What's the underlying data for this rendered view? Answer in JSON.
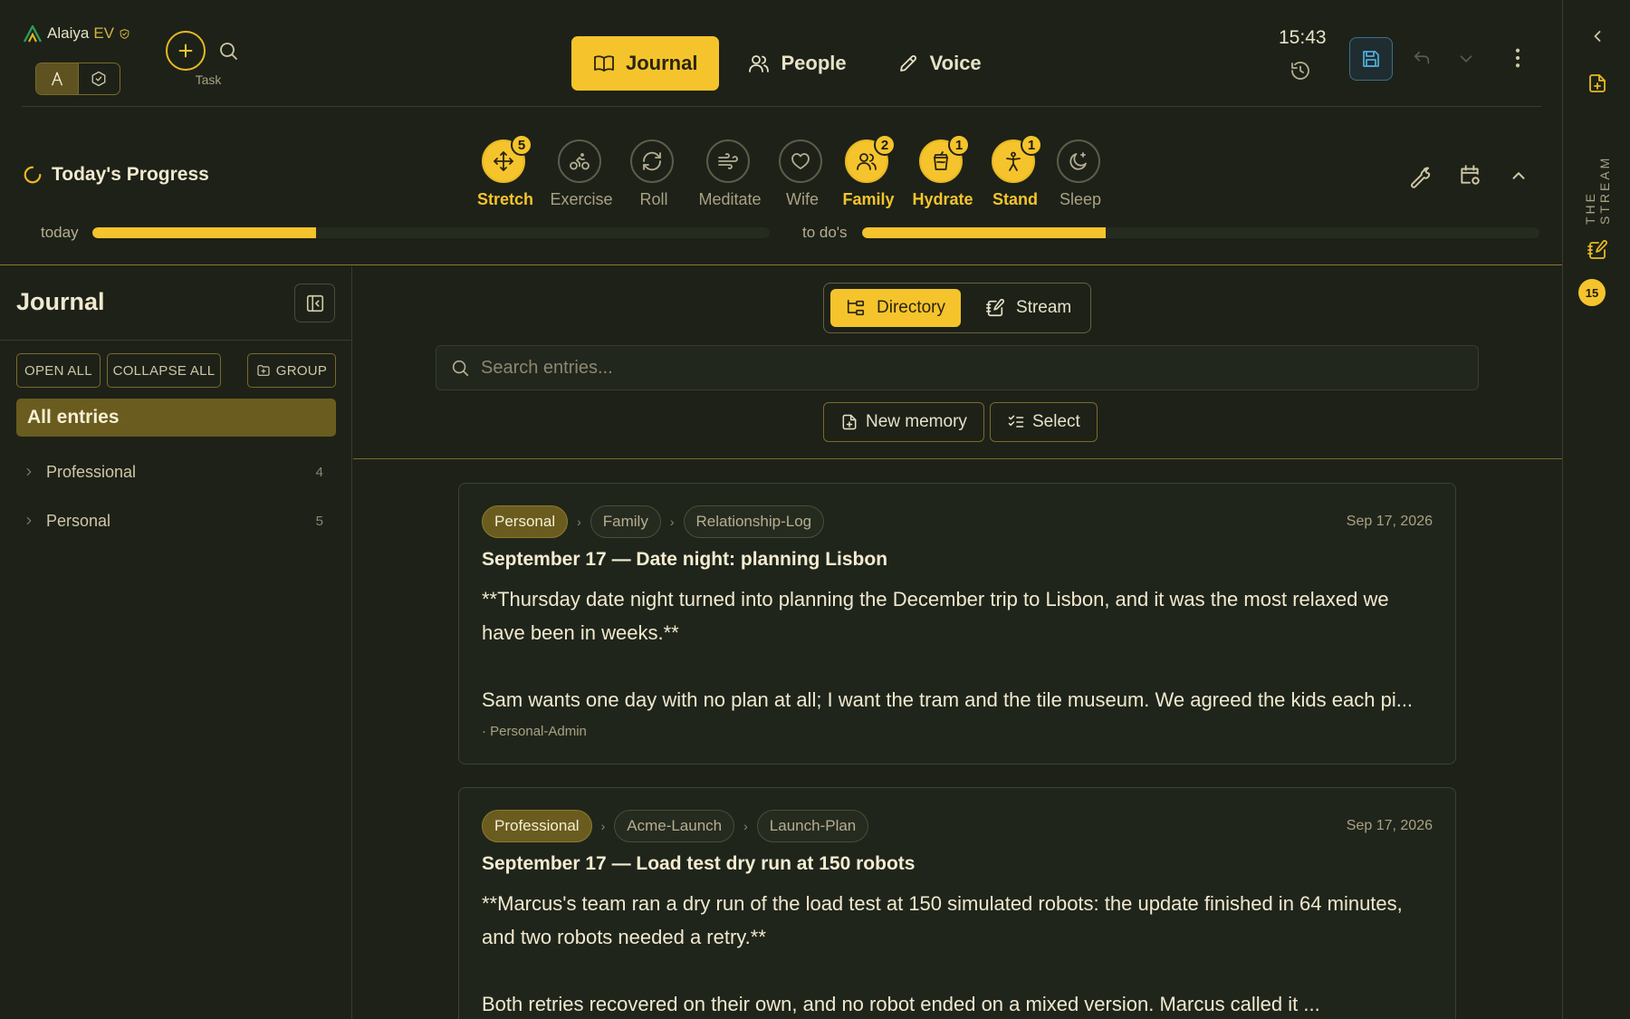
{
  "app": {
    "name": "Alaiya",
    "suffix": "EV",
    "add_task_label": "Task"
  },
  "nav": {
    "tabs": [
      {
        "label": "Journal",
        "icon": "book-icon",
        "active": true
      },
      {
        "label": "People",
        "icon": "users-icon",
        "active": false
      },
      {
        "label": "Voice",
        "icon": "pencil-icon",
        "active": false
      }
    ]
  },
  "header": {
    "clock": "15:43"
  },
  "progress": {
    "title": "Today's Progress",
    "today_label": "today",
    "todo_label": "to do's",
    "today_fraction": 0.33,
    "todo_fraction": 0.36,
    "habits": [
      {
        "label": "Stretch",
        "icon": "move-icon",
        "count": "5",
        "done": true
      },
      {
        "label": "Exercise",
        "icon": "bike-icon",
        "count": "",
        "done": false
      },
      {
        "label": "Roll",
        "icon": "refresh-icon",
        "count": "",
        "done": false
      },
      {
        "label": "Meditate",
        "icon": "wind-icon",
        "count": "",
        "done": false
      },
      {
        "label": "Wife",
        "icon": "heart-icon",
        "count": "",
        "done": false
      },
      {
        "label": "Family",
        "icon": "users-icon",
        "count": "2",
        "done": true
      },
      {
        "label": "Hydrate",
        "icon": "cup-icon",
        "count": "1",
        "done": true
      },
      {
        "label": "Stand",
        "icon": "person-icon",
        "count": "1",
        "done": true
      },
      {
        "label": "Sleep",
        "icon": "moon-icon",
        "count": "",
        "done": false
      }
    ]
  },
  "sidebar": {
    "title": "Journal",
    "open_all": "OPEN ALL",
    "collapse_all": "COLLAPSE ALL",
    "group": "GROUP",
    "all_entries": "All entries",
    "folders": [
      {
        "label": "Professional",
        "count": "4"
      },
      {
        "label": "Personal",
        "count": "5"
      }
    ]
  },
  "main": {
    "views": [
      {
        "label": "Directory",
        "active": true
      },
      {
        "label": "Stream",
        "active": false
      }
    ],
    "search_placeholder": "Search entries...",
    "new_memory": "New memory",
    "select": "Select",
    "entries": [
      {
        "crumbs": [
          "Personal",
          "Family",
          "Relationship-Log"
        ],
        "date": "Sep 17, 2026",
        "title": "September 17 — Date night: planning Lisbon",
        "p1": "**Thursday date night turned into planning the December trip to Lisbon, and it was the most relaxed we have been in weeks.**",
        "p2": "Sam wants one day with no plan at all; I want the tram and the tile museum. We agreed the kids each pi...",
        "meta": "· Personal-Admin"
      },
      {
        "crumbs": [
          "Professional",
          "Acme-Launch",
          "Launch-Plan"
        ],
        "date": "Sep 17, 2026",
        "title": "September 17 — Load test dry run at 150 robots",
        "p1": "**Marcus's team ran a dry run of the load test at 150 simulated robots: the update finished in 64 minutes, and two robots needed a retry.**",
        "p2": "Both retries recovered on their own, and no robot ended on a mixed version. Marcus called it ...",
        "meta": ""
      }
    ]
  },
  "rail": {
    "title": "THE STREAM",
    "badge": "15"
  }
}
